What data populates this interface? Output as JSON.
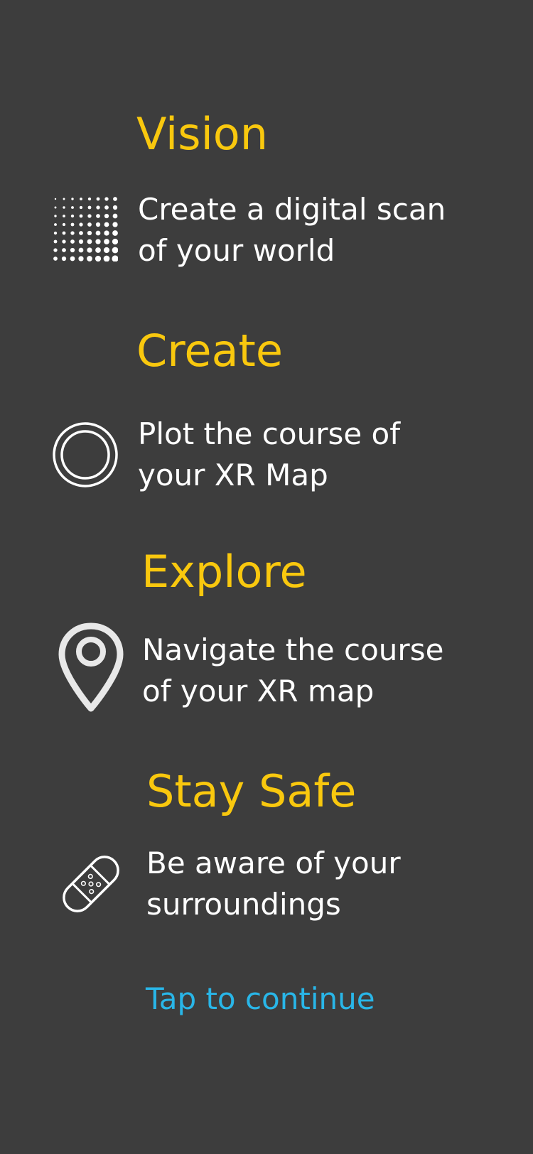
{
  "sections": [
    {
      "title": "Vision",
      "description": "Create a digital scan of your world",
      "icon": "dot-grid-icon"
    },
    {
      "title": "Create",
      "description": "Plot the course of your XR Map",
      "icon": "double-circle-icon"
    },
    {
      "title": "Explore",
      "description": "Navigate the course of your XR map",
      "icon": "map-pin-icon"
    },
    {
      "title": "Stay Safe",
      "description": "Be aware of your surroundings",
      "icon": "bandage-icon"
    }
  ],
  "continue_label": "Tap to continue",
  "colors": {
    "background": "#3d3d3d",
    "heading": "#f9c80e",
    "body_text": "#ffffff",
    "link": "#29b6e8"
  }
}
